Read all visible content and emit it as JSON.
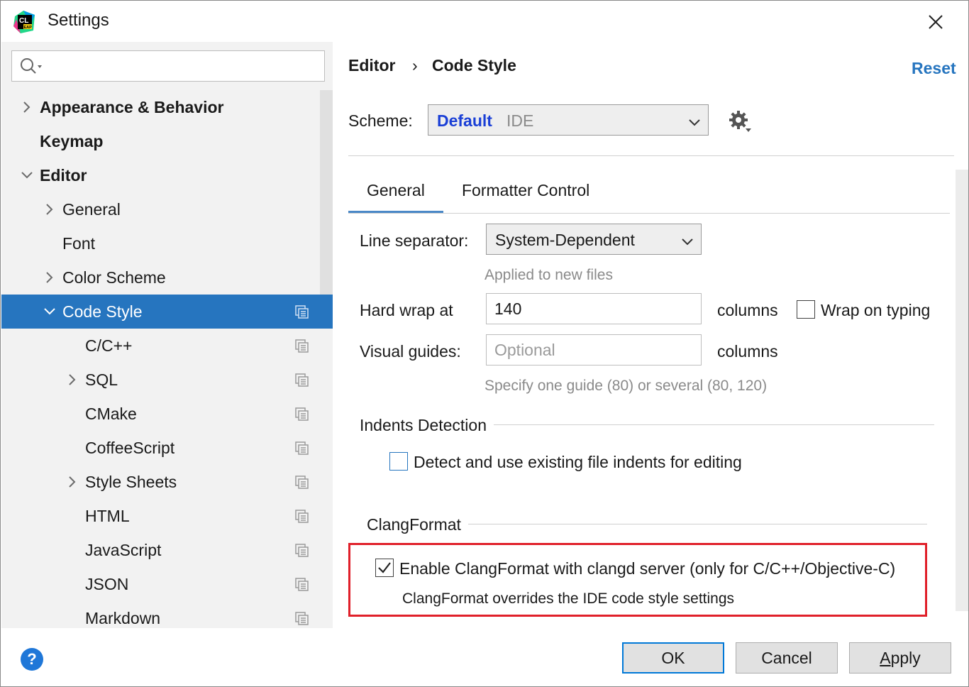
{
  "window": {
    "title": "Settings",
    "app_icon_text": "CL",
    "app_icon_badge": "EAP"
  },
  "search": {
    "placeholder": ""
  },
  "tree": [
    {
      "label": "Appearance & Behavior",
      "bold": true,
      "expand": "collapsed",
      "level": 0
    },
    {
      "label": "Keymap",
      "bold": true,
      "expand": "none",
      "level": 0
    },
    {
      "label": "Editor",
      "bold": true,
      "expand": "expanded",
      "level": 0
    },
    {
      "label": "General",
      "bold": false,
      "expand": "collapsed",
      "level": 1
    },
    {
      "label": "Font",
      "bold": false,
      "expand": "none",
      "level": 1
    },
    {
      "label": "Color Scheme",
      "bold": false,
      "expand": "collapsed",
      "level": 1
    },
    {
      "label": "Code Style",
      "bold": false,
      "expand": "expanded",
      "level": 1,
      "selected": true,
      "copy_icon": true
    },
    {
      "label": "C/C++",
      "bold": false,
      "expand": "none",
      "level": 2,
      "copy_icon": true
    },
    {
      "label": "SQL",
      "bold": false,
      "expand": "collapsed",
      "level": 2,
      "copy_icon": true
    },
    {
      "label": "CMake",
      "bold": false,
      "expand": "none",
      "level": 2,
      "copy_icon": true
    },
    {
      "label": "CoffeeScript",
      "bold": false,
      "expand": "none",
      "level": 2,
      "copy_icon": true
    },
    {
      "label": "Style Sheets",
      "bold": false,
      "expand": "collapsed",
      "level": 2,
      "copy_icon": true
    },
    {
      "label": "HTML",
      "bold": false,
      "expand": "none",
      "level": 2,
      "copy_icon": true
    },
    {
      "label": "JavaScript",
      "bold": false,
      "expand": "none",
      "level": 2,
      "copy_icon": true
    },
    {
      "label": "JSON",
      "bold": false,
      "expand": "none",
      "level": 2,
      "copy_icon": true
    },
    {
      "label": "Markdown",
      "bold": false,
      "expand": "none",
      "level": 2,
      "copy_icon": true
    }
  ],
  "breadcrumb": {
    "parent": "Editor",
    "separator": "›",
    "current": "Code Style"
  },
  "reset_label": "Reset",
  "scheme": {
    "label": "Scheme:",
    "name": "Default",
    "type": "IDE"
  },
  "tabs": [
    {
      "label": "General",
      "active": true
    },
    {
      "label": "Formatter Control",
      "active": false
    }
  ],
  "general": {
    "line_separator_label": "Line separator:",
    "line_separator_value": "System-Dependent",
    "line_separator_hint": "Applied to new files",
    "hard_wrap_label": "Hard wrap at",
    "hard_wrap_value": "140",
    "columns_label_1": "columns",
    "wrap_on_typing_label": "Wrap on typing",
    "wrap_on_typing_checked": false,
    "visual_guides_label": "Visual guides:",
    "visual_guides_placeholder": "Optional",
    "columns_label_2": "columns",
    "visual_guides_hint": "Specify one guide (80) or several (80, 120)",
    "indents_title": "Indents Detection",
    "detect_indents_label": "Detect and use existing file indents for editing",
    "detect_indents_checked": false,
    "clang_title": "ClangFormat",
    "clang_enable_label": "Enable ClangFormat with clangd server (only for C/C++/Objective-C)",
    "clang_enable_checked": true,
    "clang_note": "ClangFormat overrides the IDE code style settings"
  },
  "buttons": {
    "help": "?",
    "ok": "OK",
    "cancel": "Cancel",
    "apply_prefix": "A",
    "apply_rest": "pply"
  },
  "colors": {
    "accent": "#2675bf",
    "highlight_border": "#e0202a",
    "selected_bg": "#2675bf",
    "reset": "#2675bf"
  }
}
